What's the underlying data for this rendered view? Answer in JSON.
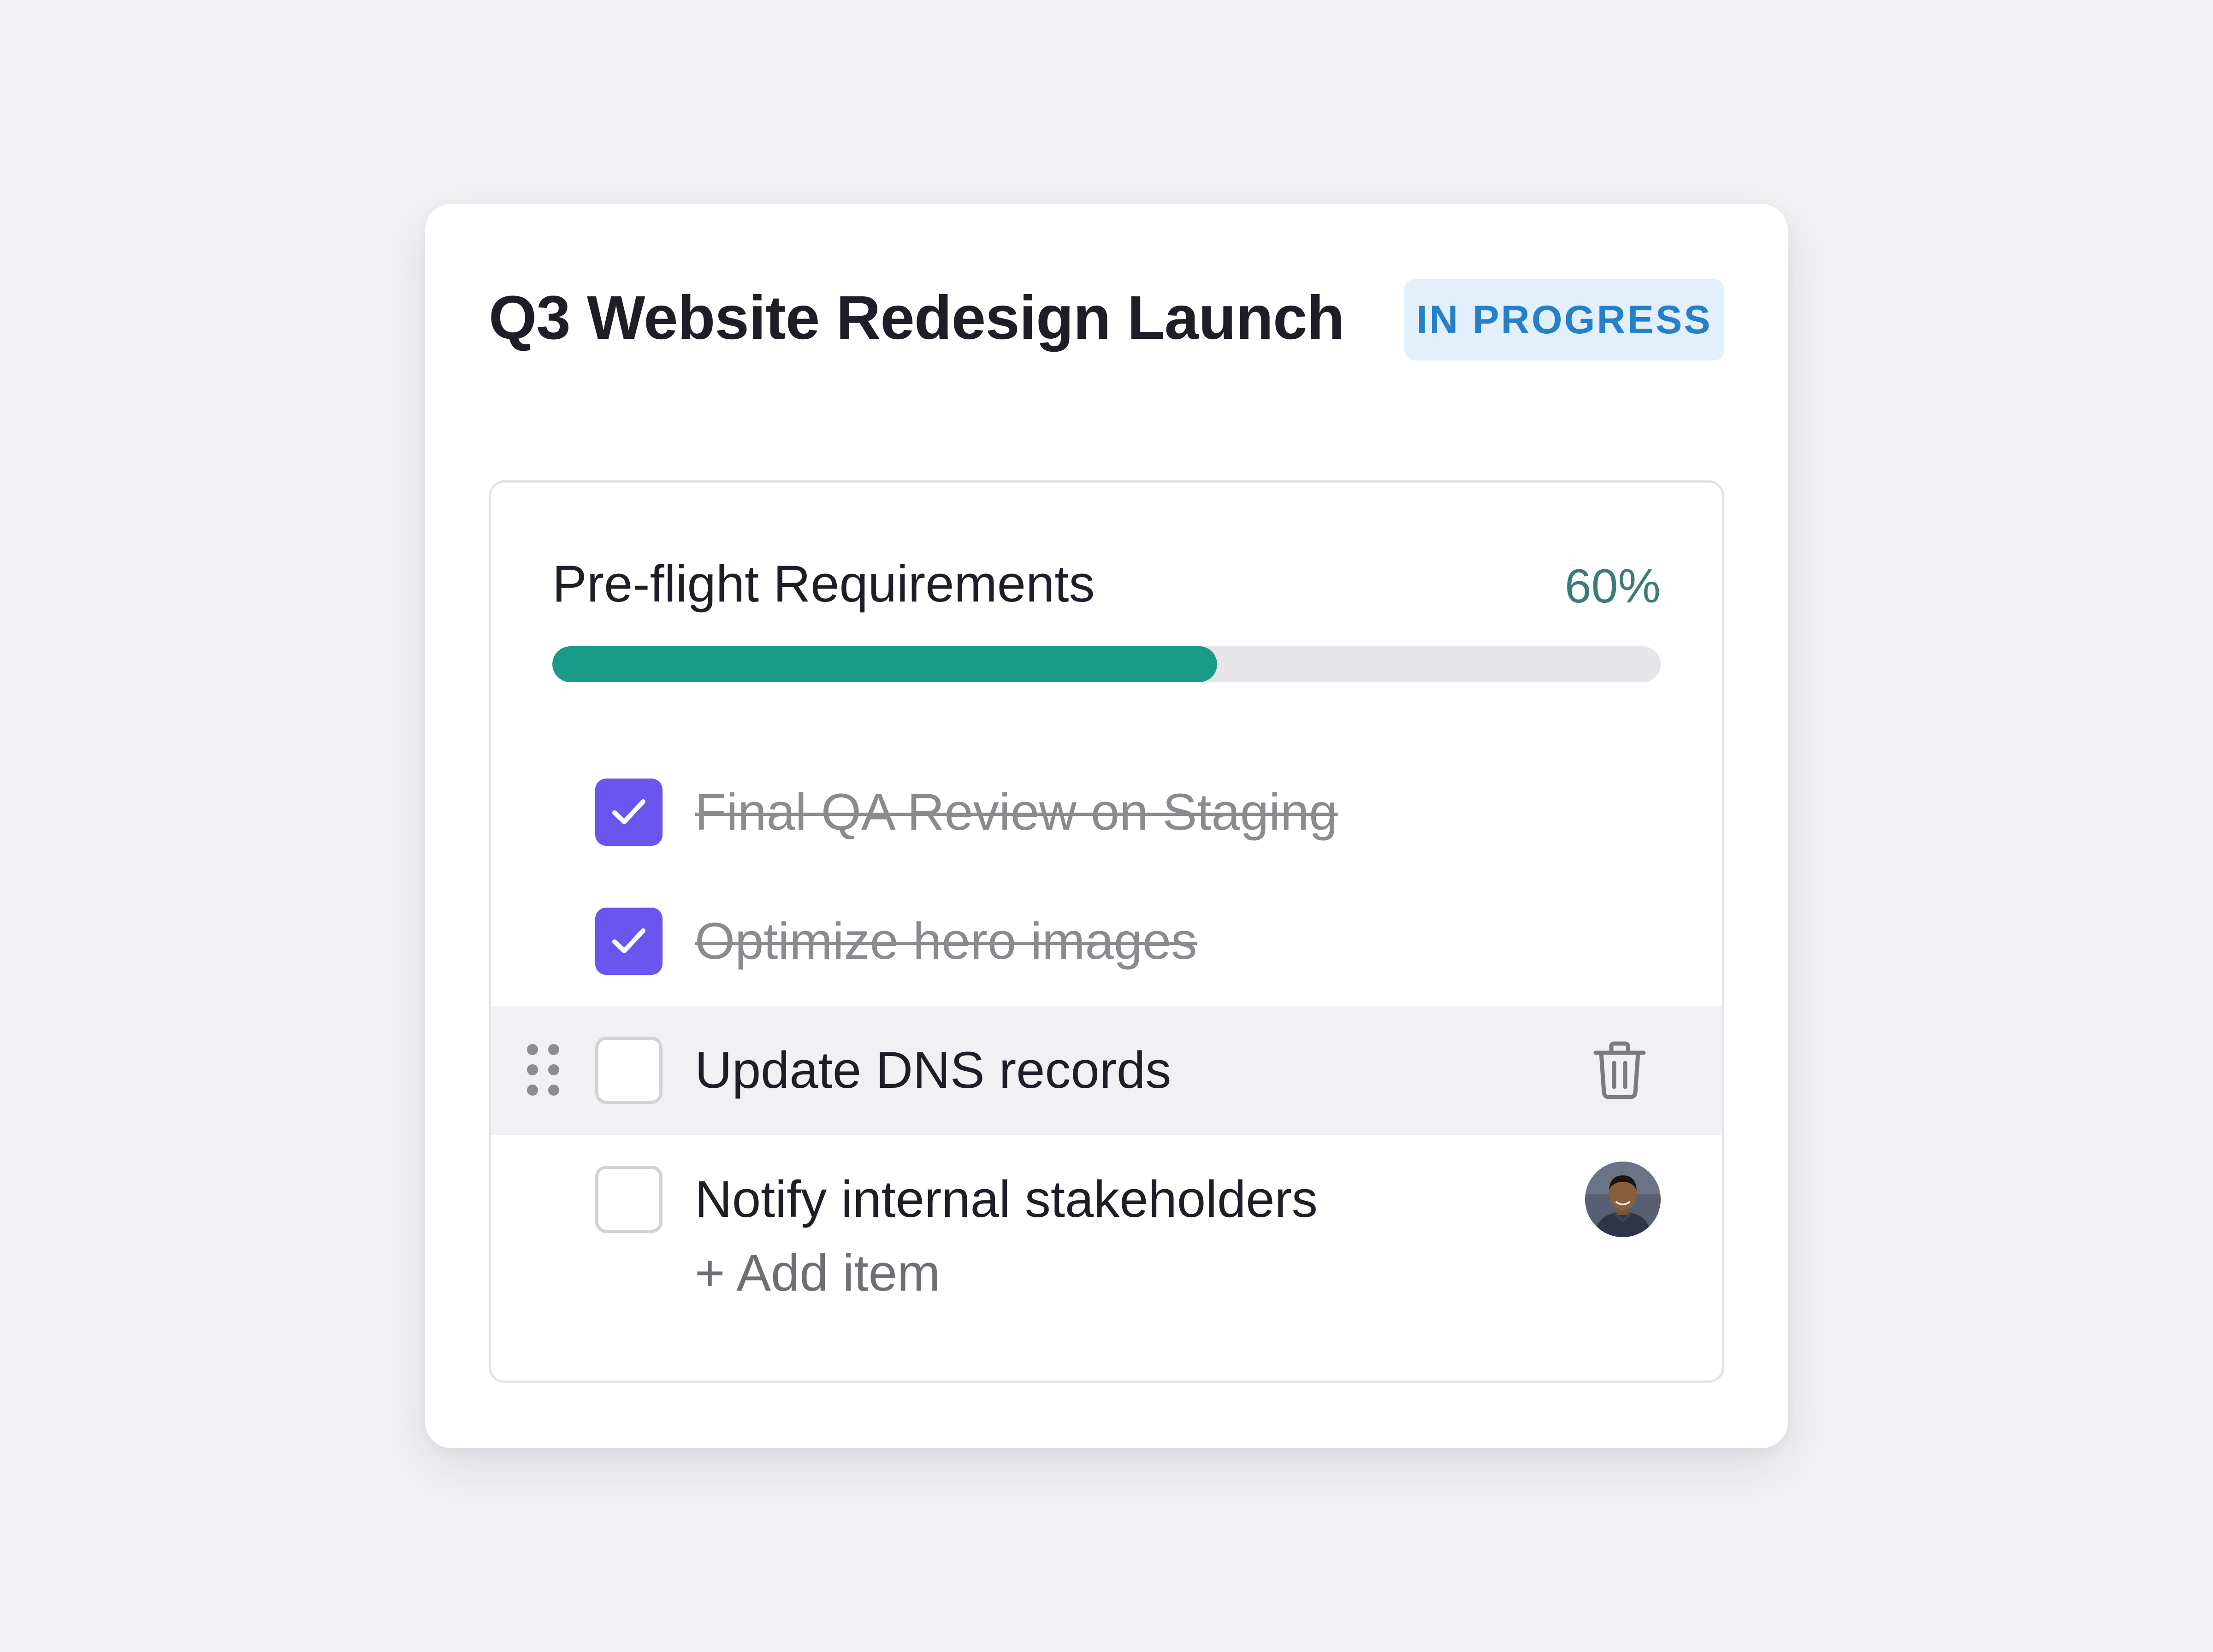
{
  "card": {
    "title": "Q3 Website Redesign Launch",
    "status": "IN PROGRESS"
  },
  "checklist": {
    "title": "Pre-flight Requirements",
    "progress_label": "60%",
    "progress_value": 0.6,
    "items": [
      {
        "label": "Final QA Review on Staging",
        "checked": true
      },
      {
        "label": "Optimize hero images",
        "checked": true
      },
      {
        "label": "Update DNS records",
        "checked": false,
        "hovered": true
      },
      {
        "label": "Notify internal stakeholders",
        "checked": false,
        "assignee": "avatar"
      }
    ],
    "add_item_label": "+ Add item"
  },
  "colors": {
    "background": "#f2f2f5",
    "accent_checkbox": "#6a55ee",
    "progress_fill": "#1a9b89",
    "badge_background": "#e4effc",
    "badge_text": "#2380c9"
  },
  "icons": {
    "check": "check-icon",
    "drag": "drag-handle-icon",
    "delete": "trash-icon",
    "assignee": "avatar"
  }
}
